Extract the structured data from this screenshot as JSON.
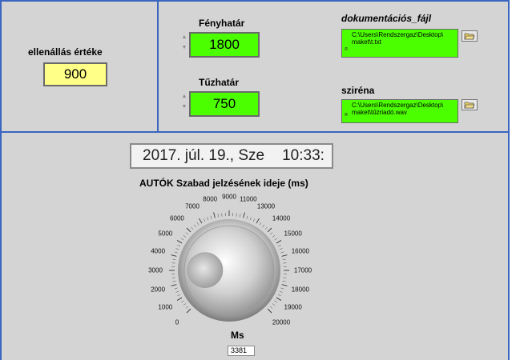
{
  "left_panel": {
    "label": "ellenállás értéke",
    "value": "900"
  },
  "fenyhatar": {
    "label": "Fényhatár",
    "value": "1800"
  },
  "tuzhatar": {
    "label": "Tűzhatár",
    "value": "750"
  },
  "doc_file": {
    "label": "dokumentációs_fájl",
    "path_line1": "C:\\Users\\Rendszergaz\\Desktop\\",
    "path_line2": "maket\\t.txt"
  },
  "sirena": {
    "label": "sziréna",
    "path_line1": "C:\\Users\\Rendszergaz\\Desktop\\",
    "path_line2": "maket\\tűzriadó.wav"
  },
  "datetime": {
    "date": "2017. júl. 19., Sze",
    "time": "10:33:"
  },
  "knob": {
    "title": "AUTÓK Szabad jelzésének ideje (ms)",
    "unit_label": "Ms",
    "value": "3381",
    "value_num": 3381,
    "min": 0,
    "max": 20000,
    "tick_labels": [
      "0",
      "1000",
      "2000",
      "3000",
      "4000",
      "5000",
      "6000",
      "7000",
      "8000",
      "9000",
      "11000",
      "13000",
      "14000",
      "15000",
      "16000",
      "17000",
      "18000",
      "19000",
      "20000"
    ]
  },
  "icons": {
    "spinner": "spinner-arrows-icon",
    "browse": "folder-open-icon",
    "path": "path-symbol-icon"
  },
  "colors": {
    "panel_bg": "#d4d4d4",
    "border": "#3a66c0",
    "numeric_green": "#4cff00",
    "numeric_yellow": "#ffff88"
  }
}
